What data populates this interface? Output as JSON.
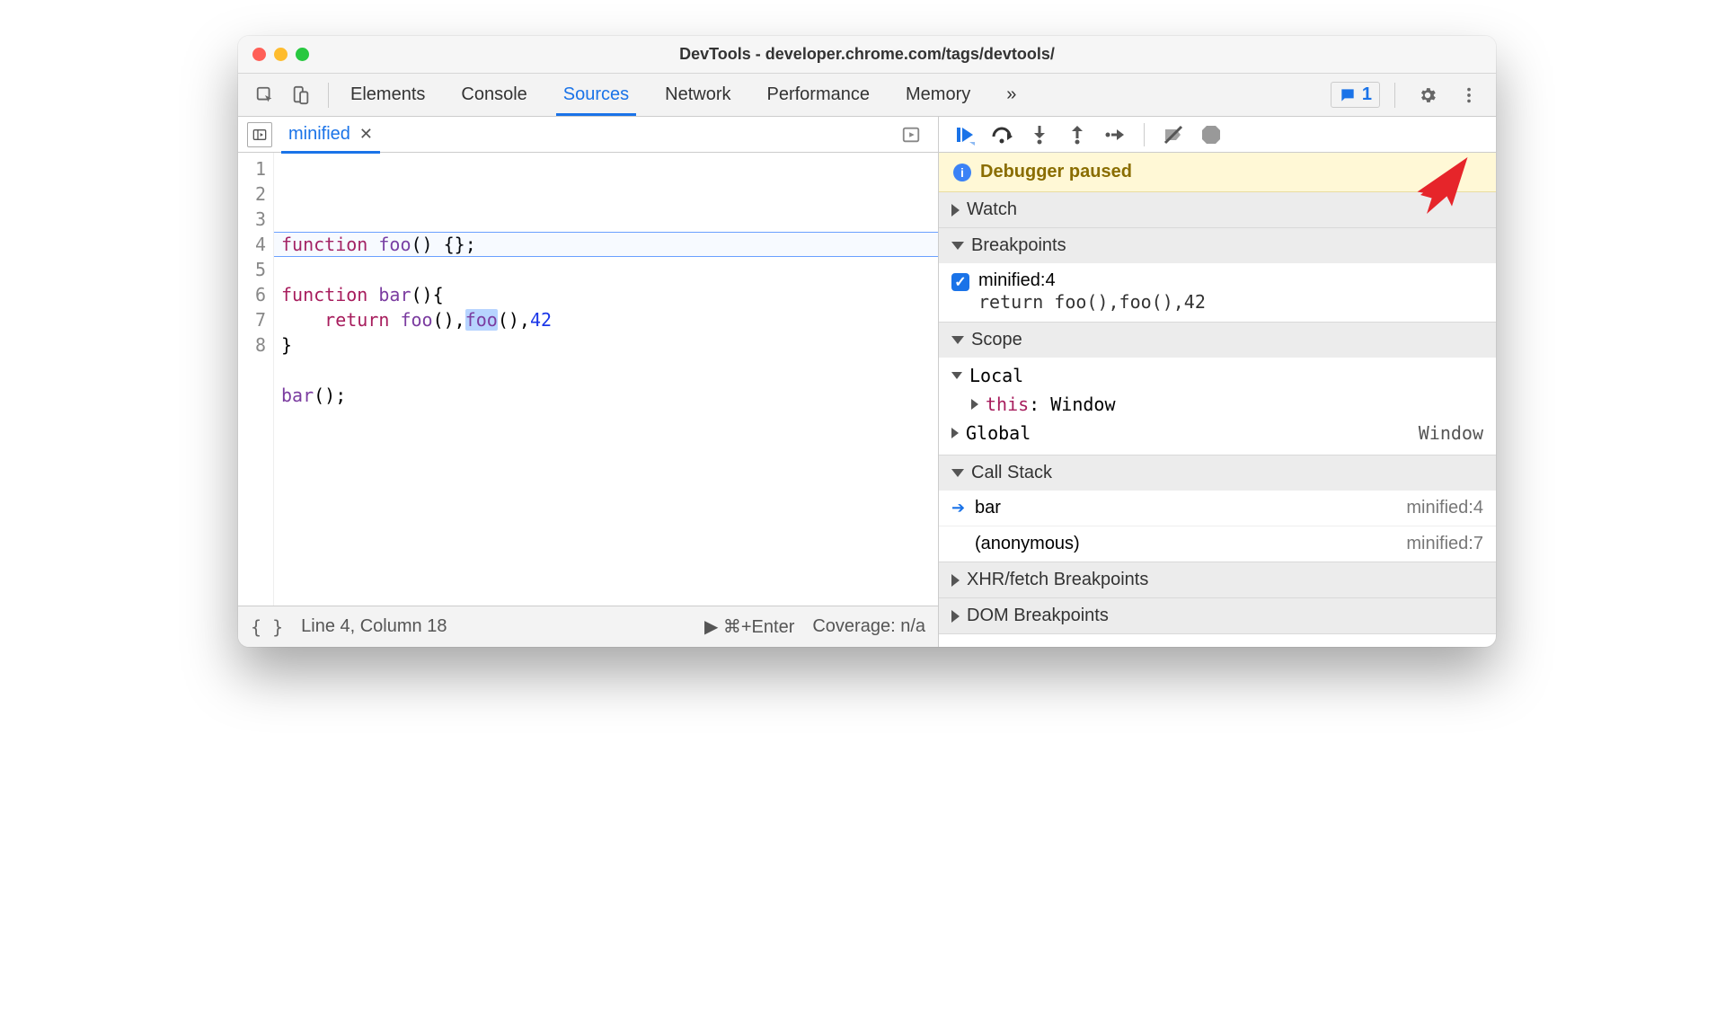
{
  "window": {
    "title": "DevTools - developer.chrome.com/tags/devtools/"
  },
  "tabs": {
    "items": [
      "Elements",
      "Console",
      "Sources",
      "Network",
      "Performance",
      "Memory"
    ],
    "activeIndex": 2,
    "overflow": "»",
    "issuesCount": "1"
  },
  "file": {
    "name": "minified"
  },
  "code": {
    "lines": [
      {
        "n": "1",
        "html": "<span class='kw'>function</span> <span class='fn'>foo</span>() {};"
      },
      {
        "n": "2",
        "html": ""
      },
      {
        "n": "3",
        "html": "<span class='kw'>function</span> <span class='fn'>bar</span>(){"
      },
      {
        "n": "4",
        "html": "    <span class='kw'>return</span> <span class='fn'>foo</span>(),<span class='sel'><span class='fn'>foo</span></span>(),<span class='num'>42</span>"
      },
      {
        "n": "5",
        "html": "}"
      },
      {
        "n": "6",
        "html": ""
      },
      {
        "n": "7",
        "html": "<span class='fn'>bar</span>();"
      },
      {
        "n": "8",
        "html": ""
      }
    ]
  },
  "status": {
    "pos": "Line 4, Column 18",
    "run": "▶ ⌘+Enter",
    "coverage": "Coverage: n/a"
  },
  "debugger": {
    "notice": "Debugger paused",
    "sections": {
      "watch": "Watch",
      "breakpoints": {
        "title": "Breakpoints",
        "label": "minified:4",
        "code": "return foo(),foo(),42"
      },
      "scope": {
        "title": "Scope",
        "local": "Local",
        "thisLabel": "this",
        "thisValue": "Window",
        "global": "Global",
        "globalValue": "Window"
      },
      "callstack": {
        "title": "Call Stack",
        "frames": [
          {
            "name": "bar",
            "loc": "minified:4",
            "current": true
          },
          {
            "name": "(anonymous)",
            "loc": "minified:7",
            "current": false
          }
        ]
      },
      "xhr": "XHR/fetch Breakpoints",
      "dom": "DOM Breakpoints"
    }
  }
}
